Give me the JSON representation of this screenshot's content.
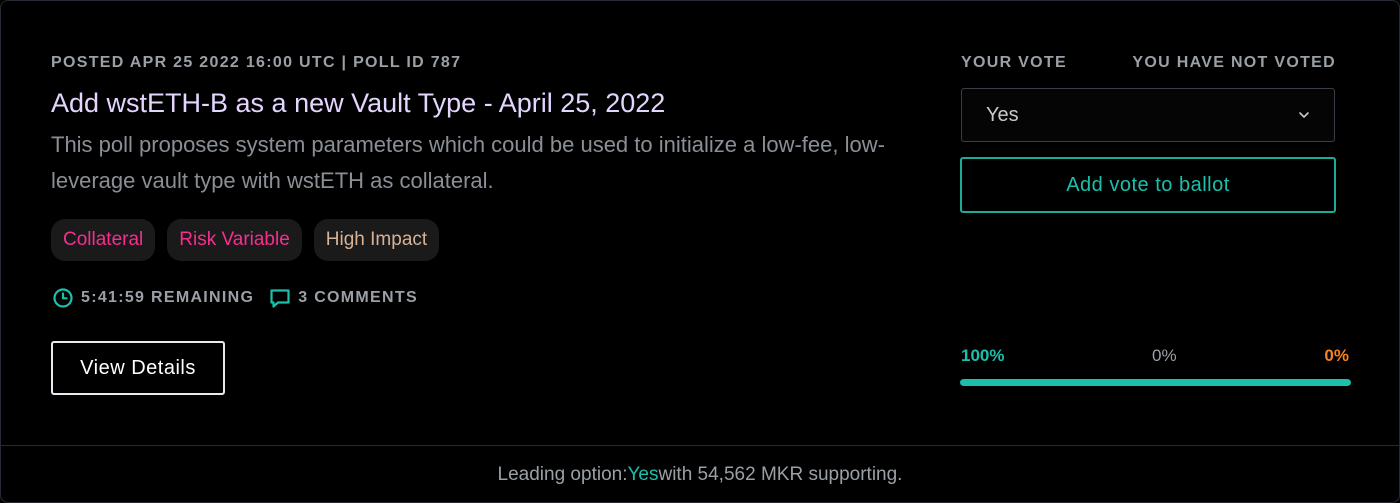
{
  "poll": {
    "meta": "POSTED APR 25 2022 16:00 UTC | POLL ID 787",
    "title": "Add wstETH-B as a new Vault Type - April 25, 2022",
    "description": "This poll proposes system parameters which could be used to initialize a low-fee, low-leverage vault type with wstETH as collateral.",
    "tags": [
      {
        "label": "Collateral",
        "color": "#f72e8d"
      },
      {
        "label": "Risk Variable",
        "color": "#f72e8d"
      },
      {
        "label": "High Impact",
        "color": "#d7b295"
      }
    ],
    "remaining": "5:41:59 REMAINING",
    "comments": "3 COMMENTS",
    "clock_icon": "clock-icon",
    "comment_icon": "comment-icon",
    "details_button": "View Details"
  },
  "vote": {
    "your_vote_label": "YOUR VOTE",
    "status_label": "YOU HAVE NOT VOTED",
    "selected_option": "Yes",
    "dropdown_icon": "chevron-down-icon",
    "ballot_button": "Add vote to ballot"
  },
  "tally": {
    "yes_percent": "100%",
    "abstain_percent": "0%",
    "no_percent": "0%",
    "yes_fraction": 1.0,
    "yes_color": "#1ac0ab",
    "no_color": "#f7811e"
  },
  "footer": {
    "prefix": "Leading option: ",
    "leading_option": "Yes",
    "suffix": " with 54,562 MKR supporting."
  },
  "colors": {
    "background": "#000000",
    "accent": "#1ac0ab",
    "title": "#e4d5ff",
    "muted": "#9aa0a6"
  }
}
